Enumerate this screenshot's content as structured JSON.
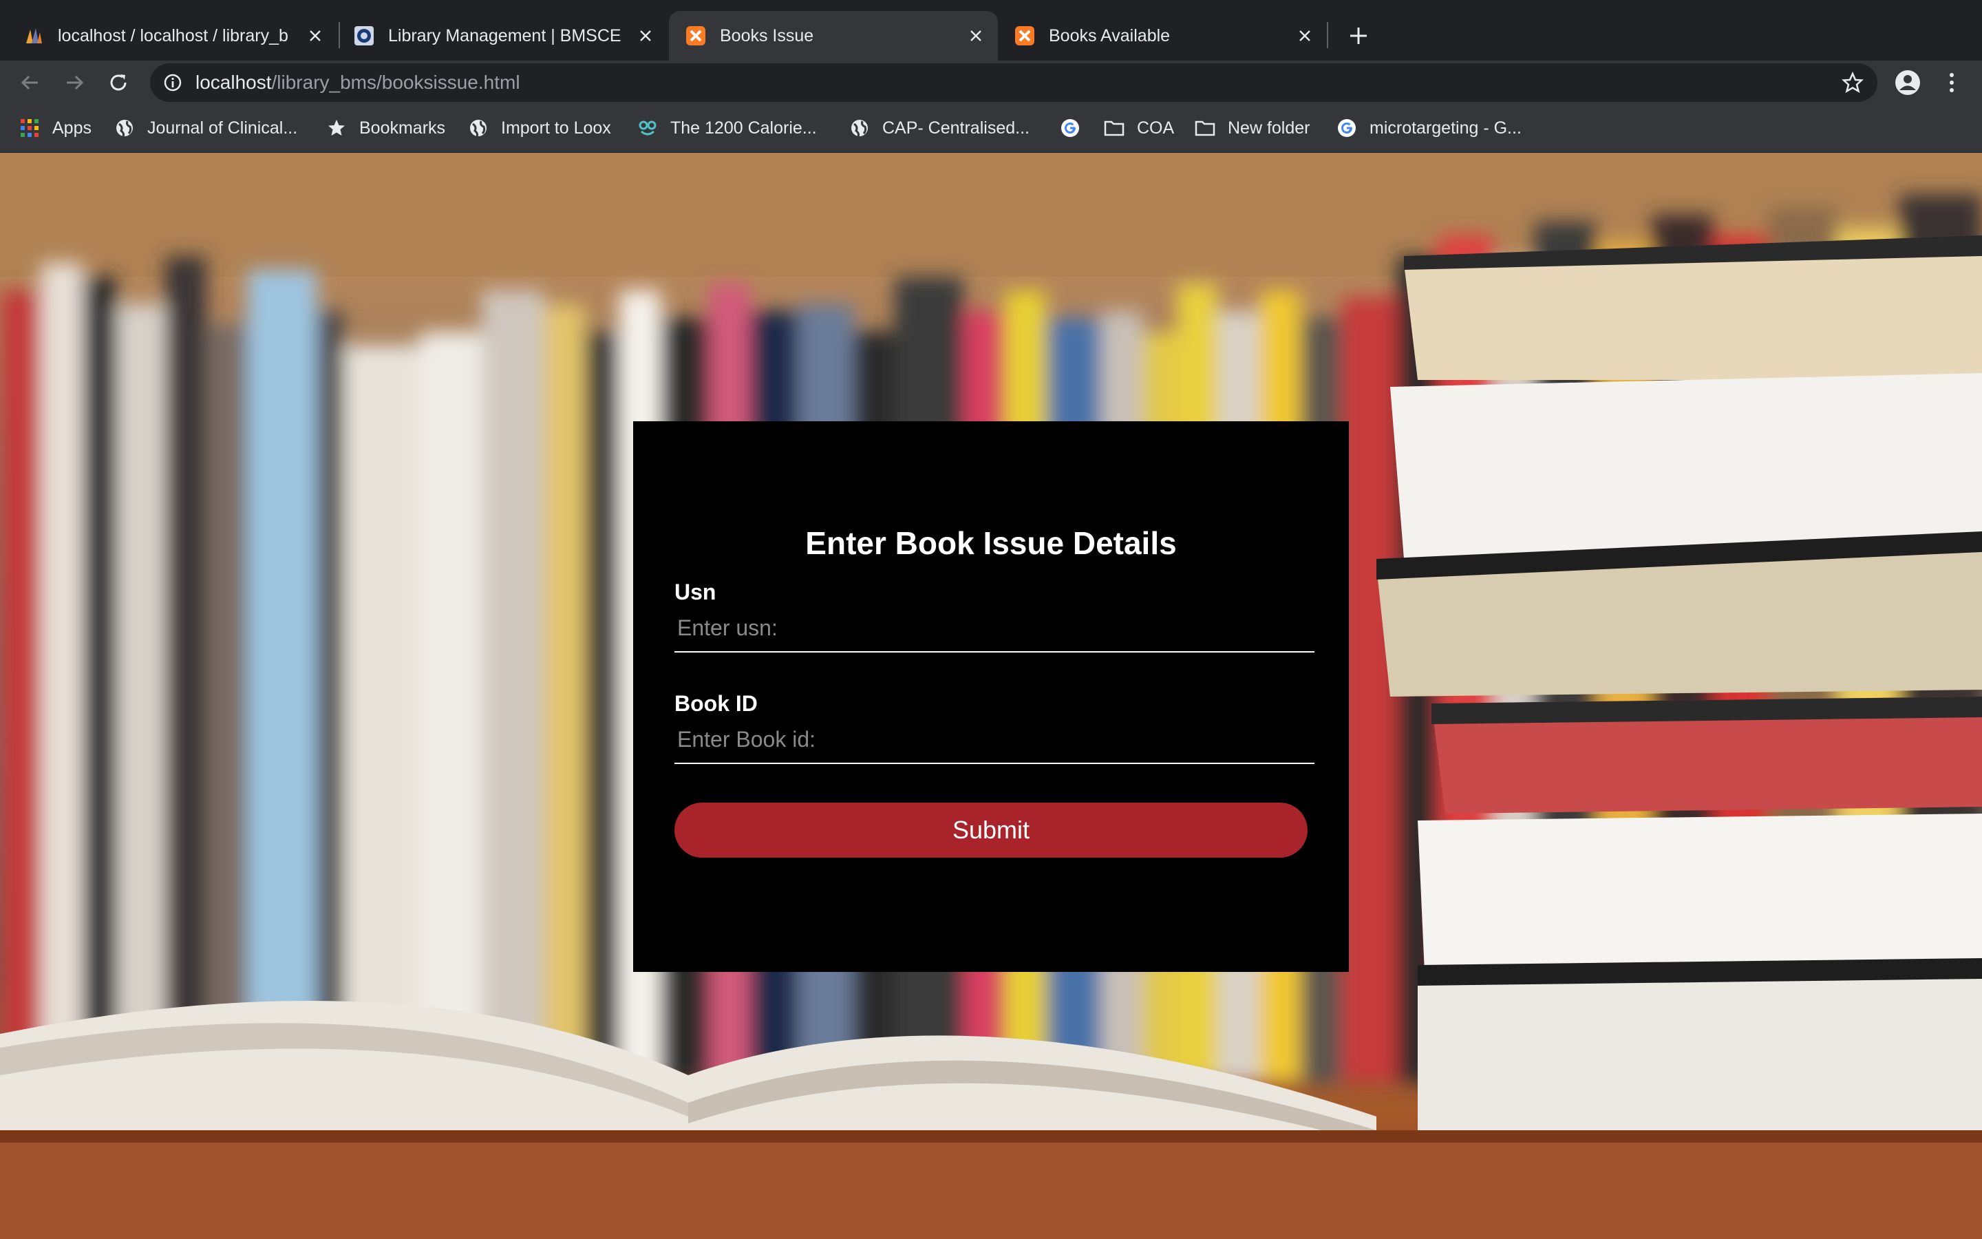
{
  "browser": {
    "tabs": [
      {
        "title": "localhost / localhost / library_b",
        "favicon": "phpmyadmin-icon"
      },
      {
        "title": "Library Management | BMSCE",
        "favicon": "bmsce-logo-icon"
      },
      {
        "title": "Books Issue",
        "favicon": "xampp-icon",
        "active": true
      },
      {
        "title": "Books Available",
        "favicon": "xampp-icon"
      }
    ],
    "address": {
      "host": "localhost",
      "path": "/library_bms/booksissue.html"
    },
    "bookmarks": [
      {
        "label": "Apps",
        "icon": "apps-grid-icon"
      },
      {
        "label": "Journal of Clinical...",
        "icon": "globe-icon"
      },
      {
        "label": "Bookmarks",
        "icon": "star-icon"
      },
      {
        "label": "Import to Loox",
        "icon": "globe-icon"
      },
      {
        "label": "The 1200 Calorie...",
        "icon": "calorie-icon"
      },
      {
        "label": "CAP- Centralised...",
        "icon": "globe-icon"
      },
      {
        "label": "",
        "icon": "google-icon"
      },
      {
        "label": "COA",
        "icon": "folder-icon"
      },
      {
        "label": "New folder",
        "icon": "folder-icon"
      },
      {
        "label": "microtargeting - G...",
        "icon": "google-icon"
      }
    ]
  },
  "form": {
    "title": "Enter Book Issue Details",
    "usn": {
      "label": "Usn",
      "placeholder": "Enter usn:",
      "value": ""
    },
    "book_id": {
      "label": "Book ID",
      "placeholder": "Enter Book id:",
      "value": ""
    },
    "submit_label": "Submit"
  },
  "colors": {
    "panel_bg": "#000000",
    "submit_bg": "#a9232a",
    "tab_active_bg": "#35363a",
    "chrome_bg": "#202124"
  }
}
